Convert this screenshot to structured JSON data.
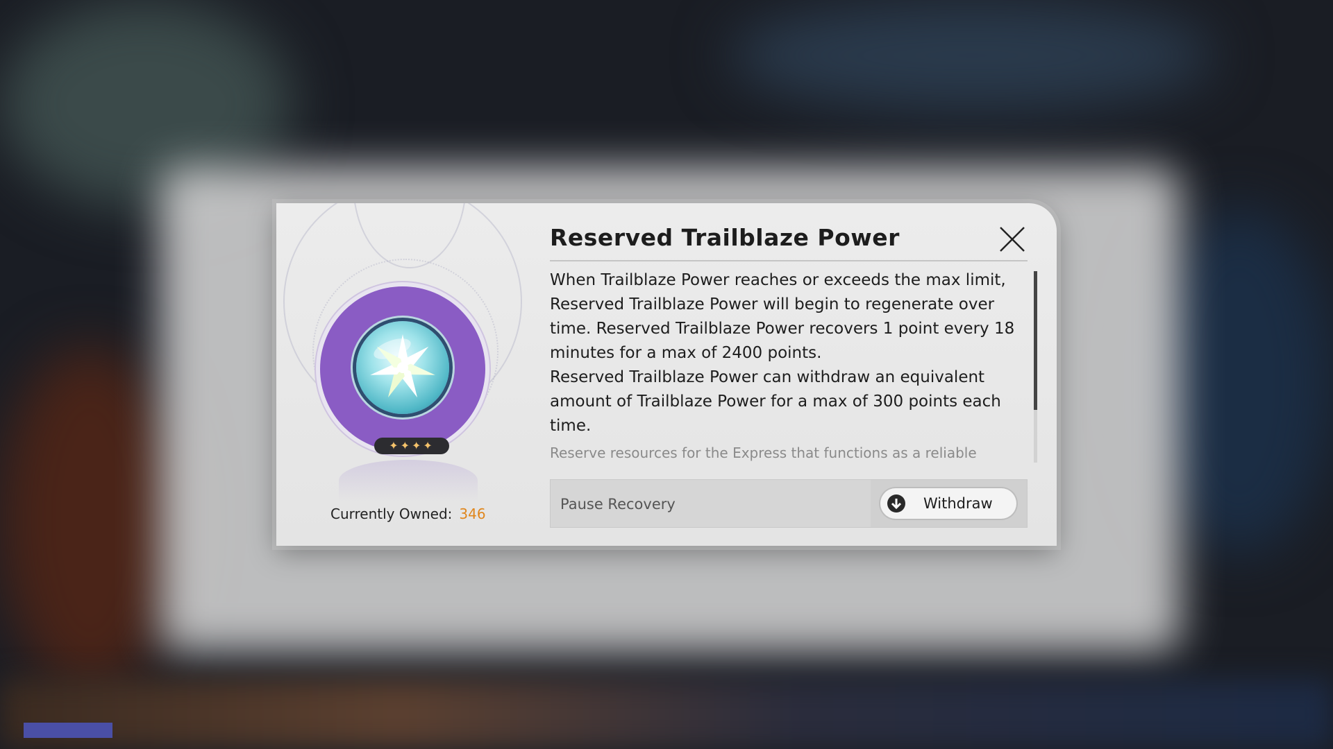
{
  "dialog": {
    "title": "Reserved Trailblaze Power",
    "description_1": "When Trailblaze Power reaches or exceeds the max limit, Reserved Trailblaze Power will begin to regenerate over time. Reserved Trailblaze Power recovers 1 point every 18 minutes for a max of 2400 points.",
    "description_2": "Reserved Trailblaze Power can withdraw an equivalent amount of Trailblaze Power for a max of 300 points each time.",
    "flavor_text": "Reserve resources for the Express that functions as a reliable safeguard for the trailblazing expedition.",
    "rarity_stars": "✦✦✦✦",
    "owned_label": "Currently Owned:",
    "owned_count": "346",
    "pause_label": "Pause Recovery",
    "withdraw_label": "Withdraw"
  },
  "icons": {
    "close": "close-icon",
    "withdraw": "download-arrow-icon",
    "item": "reserved-trailblaze-power-orb-icon"
  },
  "colors": {
    "orb_ring": "#8a5cc4",
    "owned_count": "#e0861c",
    "rarity_stars": "#f4c26b"
  }
}
